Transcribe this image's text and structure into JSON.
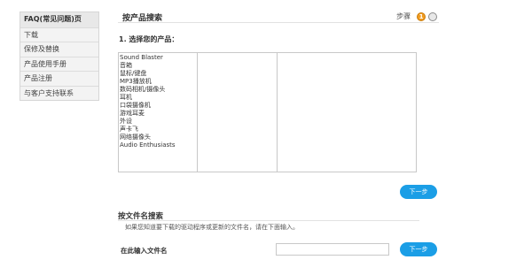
{
  "sidebar": {
    "items": [
      {
        "label": "FAQ(常见问题)页",
        "active": true
      },
      {
        "label": "下载",
        "active": false
      },
      {
        "label": "保修及替换",
        "active": false
      },
      {
        "label": "产品使用手册",
        "active": false
      },
      {
        "label": "产品注册",
        "active": false
      },
      {
        "label": "与客户支持联系",
        "active": false
      }
    ]
  },
  "search": {
    "title": "按产品搜索",
    "steps_label": "步骤",
    "step1": "1",
    "prompt": "1. 选择您的产品：",
    "products": [
      "Sound Blaster",
      "音箱",
      "鼠标/键盘",
      "MP3播放机",
      "数码相机/摄像头",
      "耳机",
      "口袋摄像机",
      "游戏耳麦",
      "外设",
      "声卡飞",
      "网络摄像头",
      "Audio Enthusiasts"
    ],
    "next_label": "下一步"
  },
  "file_search": {
    "title": "按文件名搜索",
    "description": "如果您知道要下载的驱动程序或更新的文件名，请在下面输入。",
    "input_label": "在此输入文件名",
    "input_value": "",
    "next_label": "下一步"
  },
  "colors": {
    "accent": "#1b9ee6",
    "step_active": "#f29c1f"
  }
}
